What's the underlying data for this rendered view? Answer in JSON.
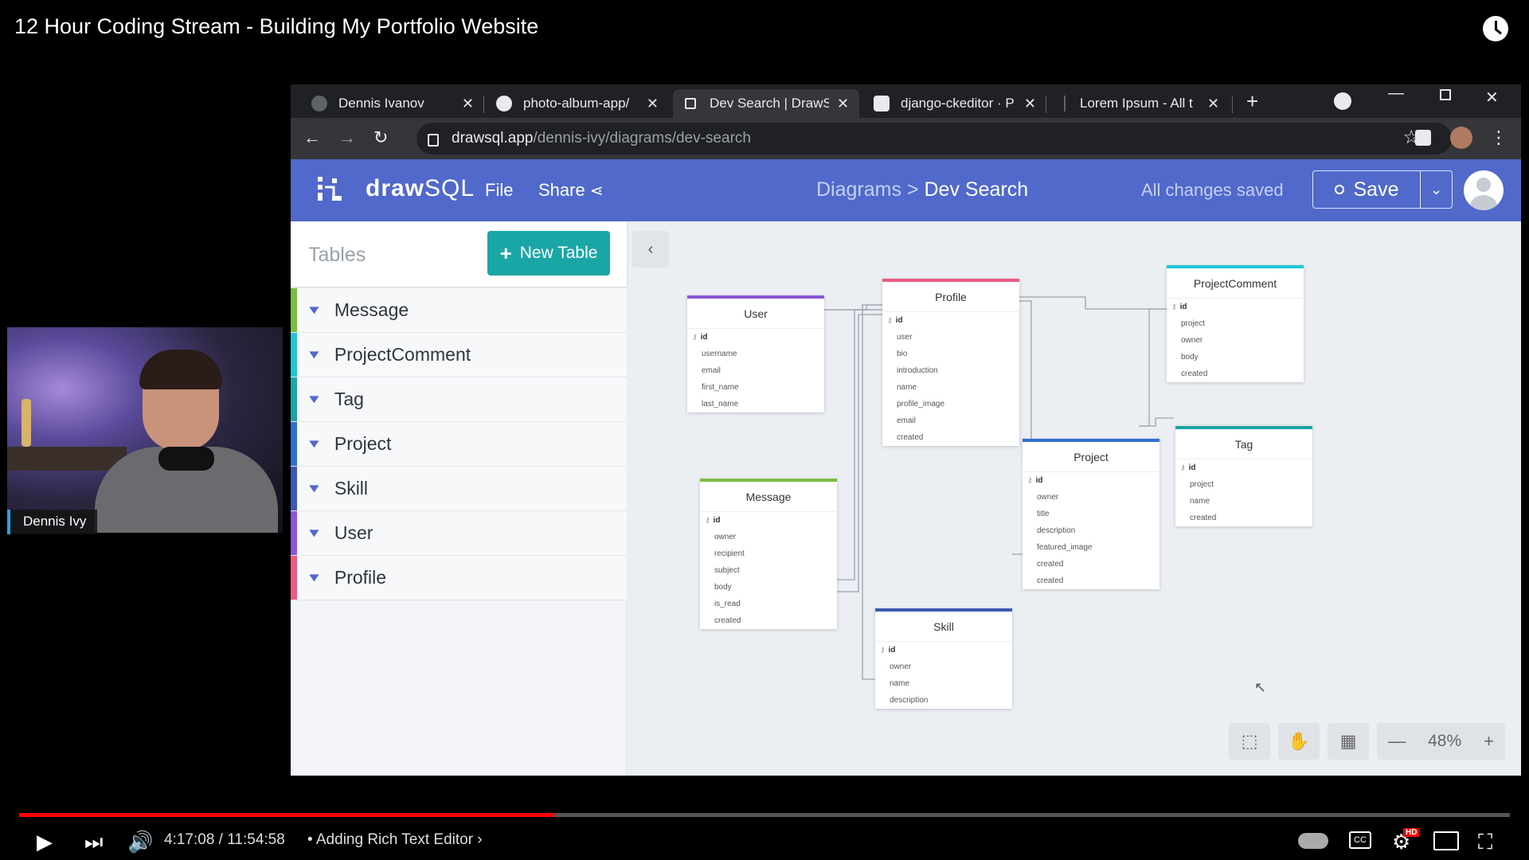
{
  "video": {
    "title": "12 Hour Coding Stream - Building My Portfolio Website",
    "presenter_name": "Dennis Ivy",
    "time_current": "4:17:08",
    "time_sep": " / ",
    "time_total": "11:54:58",
    "chapter": "• Adding Rich Text Editor ›",
    "progress_fraction": 0.359,
    "hd_label": "HD"
  },
  "browser": {
    "tabs": [
      {
        "label": "Dennis Ivanov",
        "icon": "globe-icon",
        "active": false
      },
      {
        "label": "photo-album-app/",
        "icon": "github-icon",
        "active": false
      },
      {
        "label": "Dev Search | DrawS",
        "icon": "drawsql-icon",
        "active": true
      },
      {
        "label": "django-ckeditor · P",
        "icon": "package-icon",
        "active": false
      },
      {
        "label": "Lorem Ipsum - All t",
        "icon": "doc-icon",
        "active": false
      }
    ],
    "new_tab": "+",
    "url_host": "drawsql.app",
    "url_path": "/dennis-ivy/diagrams/dev-search"
  },
  "app": {
    "brand_bold": "draw",
    "brand_light": "SQL",
    "menu": {
      "file": "File",
      "share": "Share"
    },
    "breadcrumb": {
      "parent": "Diagrams",
      "sep": " > ",
      "current": "Dev Search"
    },
    "save_status": "All changes saved",
    "save_label": "Save",
    "sidebar": {
      "title": "Tables",
      "new_table_label": "New Table",
      "items": [
        {
          "label": "Message",
          "color": "#7cbd3e"
        },
        {
          "label": "ProjectComment",
          "color": "#1ec7d8"
        },
        {
          "label": "Tag",
          "color": "#1ba6a6"
        },
        {
          "label": "Project",
          "color": "#2f6fd0"
        },
        {
          "label": "Skill",
          "color": "#3d58b8"
        },
        {
          "label": "User",
          "color": "#8a57d6"
        },
        {
          "label": "Profile",
          "color": "#ee5a82"
        }
      ]
    },
    "tables": {
      "user": {
        "name": "User",
        "color": "#8a57d6",
        "columns": [
          "id",
          "username",
          "email",
          "first_name",
          "last_name"
        ]
      },
      "profile": {
        "name": "Profile",
        "color": "#ee5a82",
        "columns": [
          "id",
          "user",
          "bio",
          "introduction",
          "name",
          "profile_image",
          "email",
          "created"
        ]
      },
      "projectcomment": {
        "name": "ProjectComment",
        "color": "#1ec7d8",
        "columns": [
          "id",
          "project",
          "owner",
          "body",
          "created"
        ]
      },
      "message": {
        "name": "Message",
        "color": "#7cbd3e",
        "columns": [
          "id",
          "owner",
          "recipient",
          "subject",
          "body",
          "is_read",
          "created"
        ]
      },
      "project": {
        "name": "Project",
        "color": "#2f6fd0",
        "columns": [
          "id",
          "owner",
          "title",
          "description",
          "featured_image",
          "created",
          "created"
        ]
      },
      "tag": {
        "name": "Tag",
        "color": "#1ba6a6",
        "columns": [
          "id",
          "project",
          "name",
          "created"
        ]
      },
      "skill": {
        "name": "Skill",
        "color": "#3d58b8",
        "columns": [
          "id",
          "owner",
          "name",
          "description"
        ]
      }
    },
    "zoom_level": "48%"
  }
}
